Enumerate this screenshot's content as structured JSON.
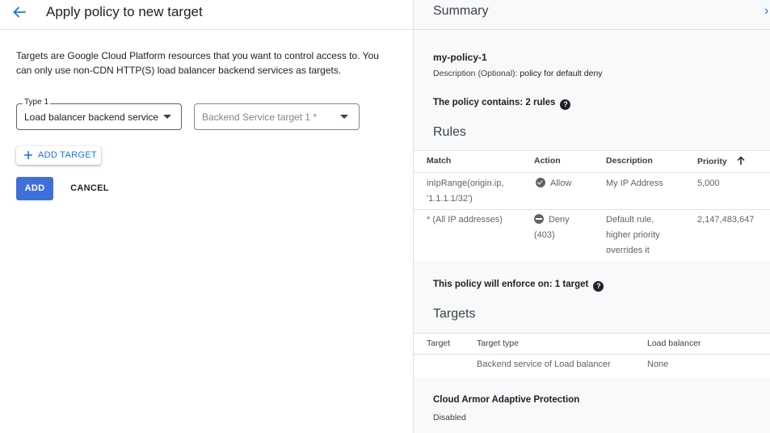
{
  "left": {
    "title": "Apply policy to new target",
    "description": "Targets are Google Cloud Platform resources that you want to control access to. You can only use non-CDN HTTP(S) load balancer backend services as targets.",
    "type_select": {
      "legend": "Type 1",
      "value": "Load balancer backend service"
    },
    "backend_select": {
      "placeholder": "Backend Service target 1 *"
    },
    "add_target_label": "ADD TARGET",
    "add_button": "ADD",
    "cancel_button": "CANCEL"
  },
  "summary": {
    "title": "Summary",
    "policy_name": "my-policy-1",
    "description_label": "Description (Optional):",
    "description_value": "policy for default deny",
    "contains_text": "The policy contains: 2 rules",
    "rules_heading": "Rules",
    "rules_columns": [
      "Match",
      "Action",
      "Description",
      "Priority"
    ],
    "rules": [
      {
        "match_line1": "inIpRange(origin.ip,",
        "match_line2": "'1.1.1.1/32')",
        "action_line1": "Allow",
        "action_line2": "",
        "action_icon": "check-circle-icon",
        "desc_line1": "My IP Address",
        "desc_line2": "",
        "desc_line3": "",
        "priority": "5,000"
      },
      {
        "match_line1": "* (All IP addresses)",
        "match_line2": "",
        "action_line1": "Deny",
        "action_line2": "(403)",
        "action_icon": "deny-circle-icon",
        "desc_line1": "Default rule,",
        "desc_line2": "higher priority",
        "desc_line3": "overrides it",
        "priority": "2,147,483,647"
      }
    ],
    "enforce_text": "This policy will enforce on: 1 target",
    "targets_heading": "Targets",
    "targets_columns": [
      "Target",
      "Target type",
      "Load balancer"
    ],
    "targets": [
      {
        "target": "",
        "target_type": "Backend service of Load balancer",
        "load_balancer": "None"
      }
    ],
    "armor_title": "Cloud Armor Adaptive Protection",
    "armor_value": "Disabled"
  },
  "colors": {
    "accent": "#1a73e8",
    "primary_button": "#3f6fd9",
    "panel_bg": "#f8f9fa"
  }
}
